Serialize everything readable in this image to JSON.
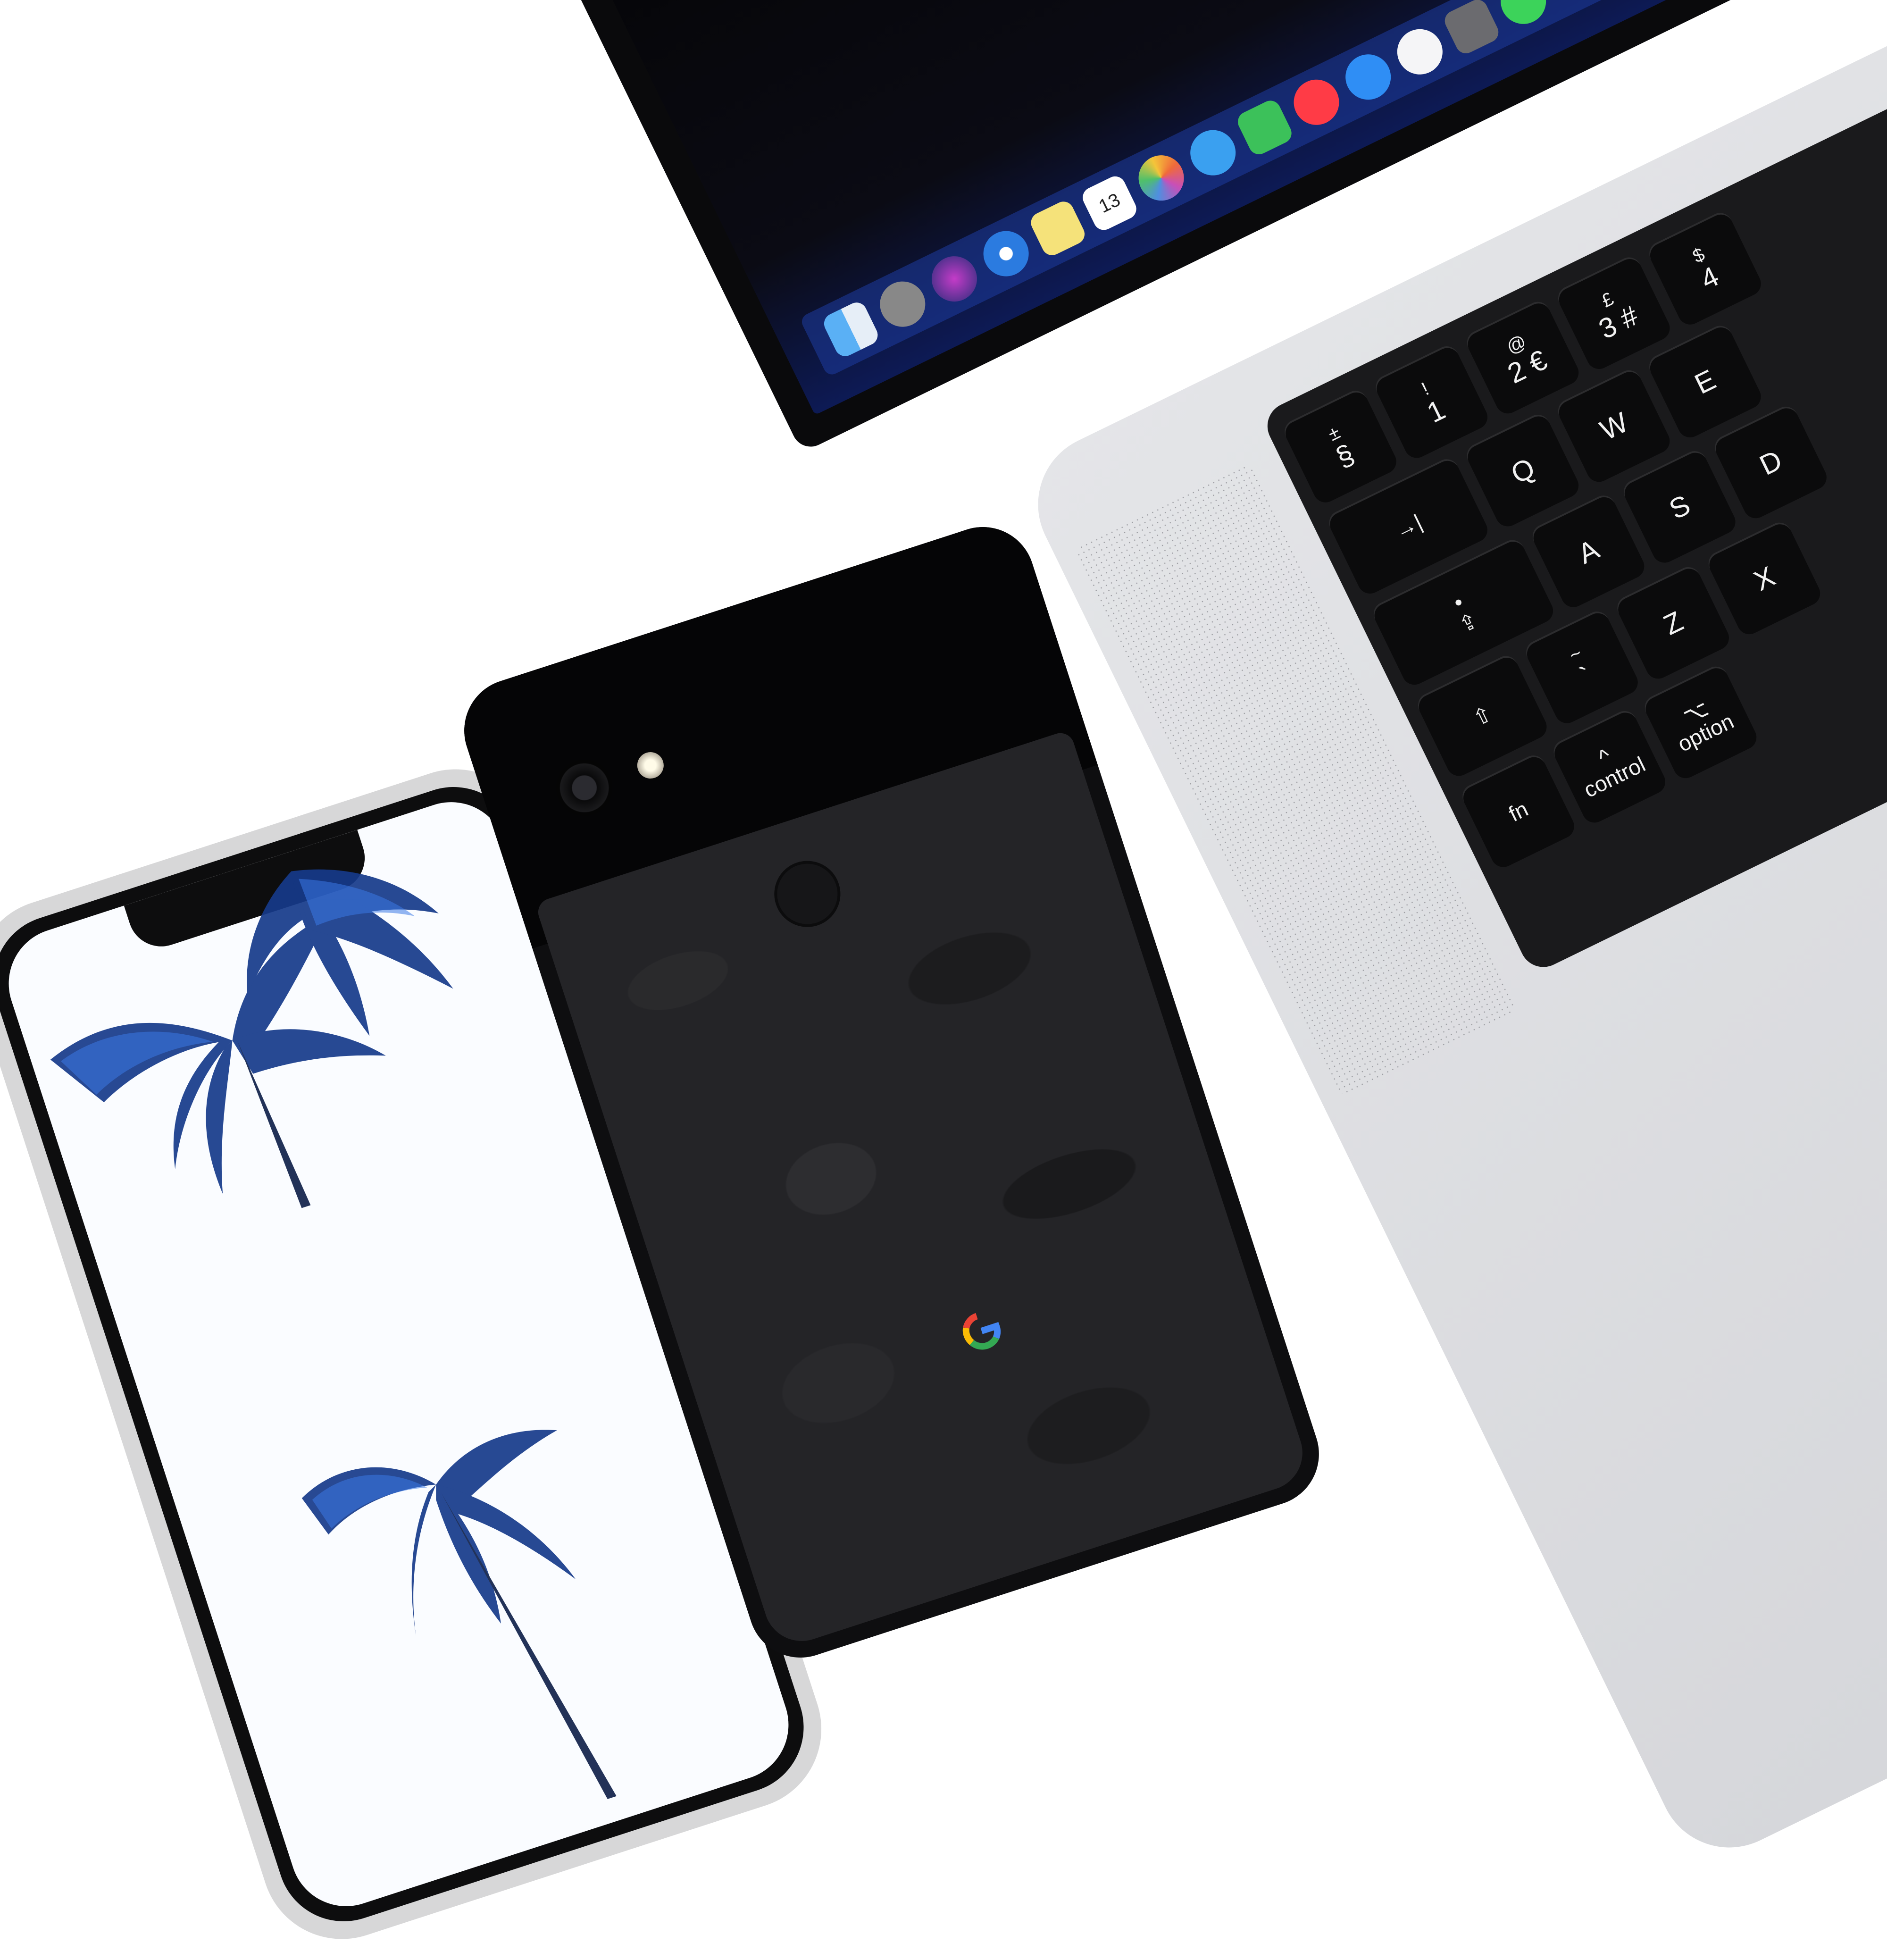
{
  "scene": {
    "description_label": "",
    "colors": {
      "background": "#ffffff",
      "laptop_aluminium": "#dcdde0",
      "keycap": "#0b0b0c",
      "pixel_camo": "#242427",
      "palm_blue": "#1f5fd6"
    }
  },
  "laptop": {
    "keys": {
      "section_top": "±",
      "section_main": "§",
      "k1_top": "!",
      "k1_main": "1",
      "k2_top": "@",
      "k2_main": "2 €",
      "k3_top": "£",
      "k3_main": "3 #",
      "k4_top": "$",
      "k4_main": "4",
      "q": "Q",
      "w": "W",
      "e": "E",
      "d": "D",
      "tab": "→|",
      "a": "A",
      "s": "S",
      "x": "X",
      "caps_dot": "•",
      "caps": "⇪",
      "tilde_top": "~",
      "tilde_main": "`",
      "z": "Z",
      "shift": "⇧",
      "control_top": "^",
      "control": "control",
      "option_top": "⌥",
      "option": "option",
      "fn": "fn"
    },
    "dock_icons": [
      "finder-icon",
      "launchpad-icon",
      "siri-icon",
      "safari-icon",
      "notes-icon",
      "calendar-icon",
      "photos-icon",
      "messages-icon",
      "facetime-icon",
      "news-icon",
      "app-store-icon",
      "music-icon",
      "preview-icon",
      "whatsapp-icon",
      "xcode-icon"
    ],
    "calendar_day": "13"
  },
  "pixel_phone": {
    "logo": "G"
  }
}
